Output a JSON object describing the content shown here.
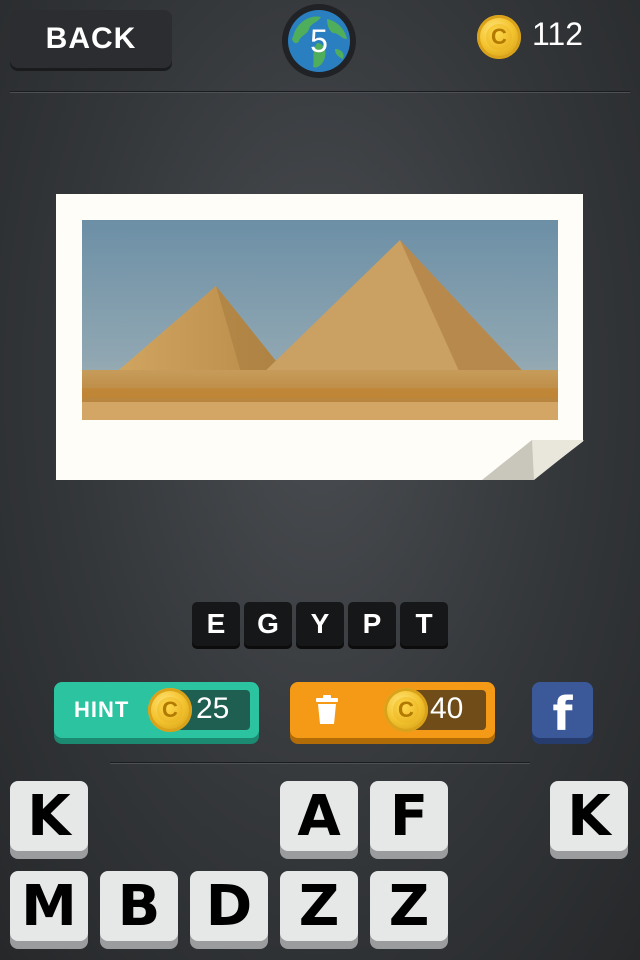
{
  "header": {
    "back_label": "BACK",
    "level": "5",
    "coins": "112"
  },
  "puzzle": {
    "answer_letters": [
      "E",
      "G",
      "Y",
      "P",
      "T"
    ]
  },
  "actions": {
    "hint_label": "HINT",
    "hint_cost": "25",
    "remove_cost": "40",
    "remove_icon": "trash-icon",
    "share_icon": "facebook-icon",
    "share_label": "f"
  },
  "keyboard": {
    "row1": [
      "K",
      "",
      "",
      "A",
      "F",
      "",
      "K"
    ],
    "row2": [
      "M",
      "B",
      "D",
      "Z",
      "Z"
    ]
  },
  "colors": {
    "hint_green": "#2cc3a0",
    "remove_orange": "#f59a16",
    "facebook_blue": "#3b5998"
  }
}
